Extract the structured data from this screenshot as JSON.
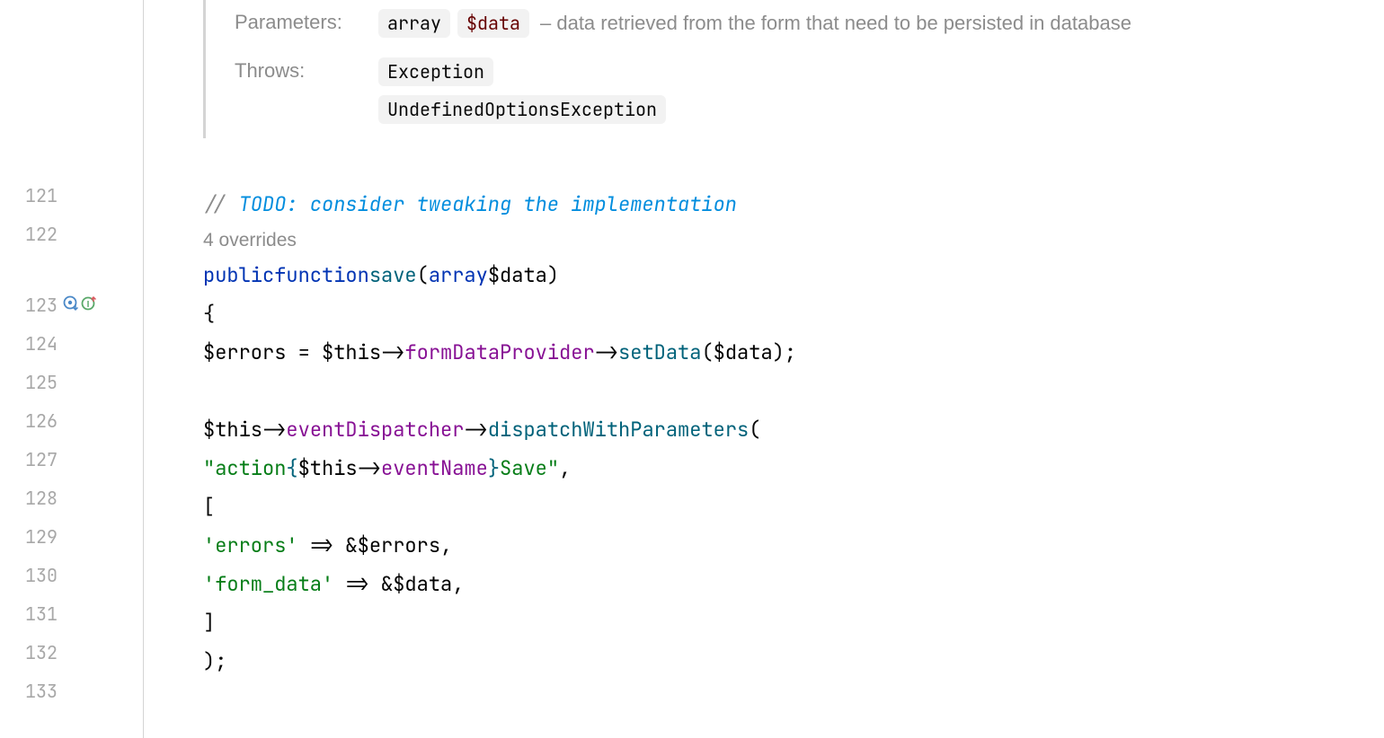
{
  "doc": {
    "params_label": "Parameters:",
    "param_type": "array",
    "param_name": "$data",
    "param_desc": "– data retrieved from the form that need to be persisted in database",
    "throws_label": "Throws:",
    "throws": [
      "Exception",
      "UndefinedOptionsException"
    ]
  },
  "inlay_overrides": "4 overrides",
  "lines": {
    "n121": "121",
    "n122": "122",
    "n123": "123",
    "n124": "124",
    "n125": "125",
    "n126": "126",
    "n127": "127",
    "n128": "128",
    "n129": "129",
    "n130": "130",
    "n131": "131",
    "n132": "132",
    "n133": "133"
  },
  "code": {
    "l122_comment_prefix": "// ",
    "l122_todo": "TODO: consider tweaking the implementation",
    "l123_public": "public",
    "l123_function": "function",
    "l123_name": "save",
    "l123_lp": "(",
    "l123_type": "array",
    "l123_param": "$data",
    "l123_rp": ")",
    "l124_brace": "{",
    "l125_var": "$errors",
    "l125_eq": " = ",
    "l125_this": "$this",
    "l125_arrow1": "->",
    "l125_prop": "formDataProvider",
    "l125_arrow2": "->",
    "l125_method": "setData",
    "l125_lp": "(",
    "l125_arg": "$data",
    "l125_rp": ");",
    "l127_this": "$this",
    "l127_arrow1": "->",
    "l127_prop": "eventDispatcher",
    "l127_arrow2": "->",
    "l127_method": "dispatchWithParameters",
    "l127_lp": "(",
    "l128_q1": "\"",
    "l128_s1": "action",
    "l128_interp_open": "{",
    "l128_this": "$this",
    "l128_arrow": "->",
    "l128_prop": "eventName",
    "l128_interp_close": "}",
    "l128_s2": "Save",
    "l128_q2": "\"",
    "l128_comma": ",",
    "l129_bracket": "[",
    "l130_key": "'errors'",
    "l130_arrow": " => ",
    "l130_amp": "&",
    "l130_var": "$errors",
    "l130_comma": ",",
    "l131_key": "'form_data'",
    "l131_arrow": " => ",
    "l131_amp": "&",
    "l131_var": "$data",
    "l131_comma": ",",
    "l132_bracket": "]",
    "l133_close": ");"
  },
  "icons": {
    "override": "override-icon",
    "implements": "implements-icon"
  }
}
